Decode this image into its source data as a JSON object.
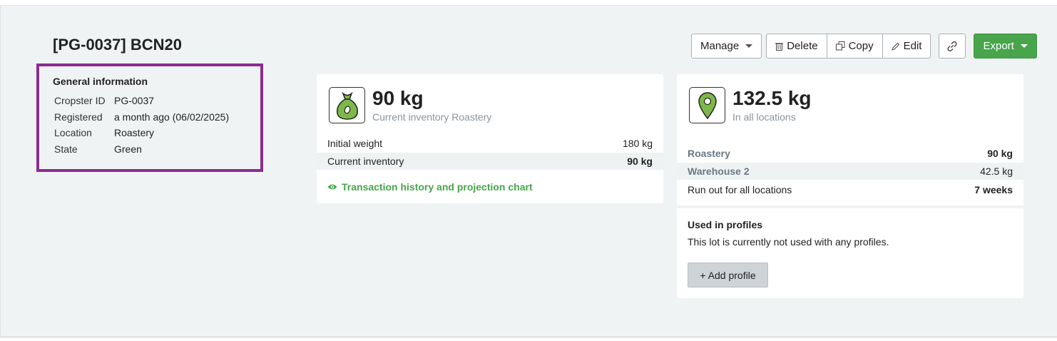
{
  "header": {
    "title": "[PG-0037] BCN20",
    "manage_label": "Manage",
    "delete_label": "Delete",
    "copy_label": "Copy",
    "edit_label": "Edit",
    "export_label": "Export"
  },
  "general": {
    "heading": "General information",
    "rows": [
      {
        "key": "Cropster ID",
        "value": "PG-0037"
      },
      {
        "key": "Registered",
        "value": "a month ago (06/02/2025)"
      },
      {
        "key": "Location",
        "value": "Roastery"
      },
      {
        "key": "State",
        "value": "Green"
      }
    ]
  },
  "inventory_card": {
    "amount": "90 kg",
    "subtitle": "Current inventory Roastery",
    "rows": [
      {
        "label": "Initial weight",
        "value": "180 kg"
      },
      {
        "label": "Current inventory",
        "value": "90 kg"
      }
    ],
    "history_link": "Transaction history and projection chart"
  },
  "locations_card": {
    "amount": "132.5 kg",
    "subtitle": "In all locations",
    "rows": [
      {
        "label": "Roastery",
        "value": "90 kg"
      },
      {
        "label": "Warehouse 2",
        "value": "42.5 kg"
      },
      {
        "label": "Run out for all locations",
        "value": "7 weeks"
      }
    ],
    "profiles_title": "Used in profiles",
    "profiles_text": "This lot is currently not used with any profiles.",
    "add_profile_label": "+ Add profile"
  },
  "colors": {
    "accent_green": "#48a54c",
    "highlight_border": "#8b2c8f",
    "icon_fill": "#7cb84a"
  },
  "icons": [
    "trash-icon",
    "copy-icon",
    "pencil-icon",
    "link-icon",
    "money-bag-icon",
    "map-pin-icon",
    "eye-icon"
  ]
}
